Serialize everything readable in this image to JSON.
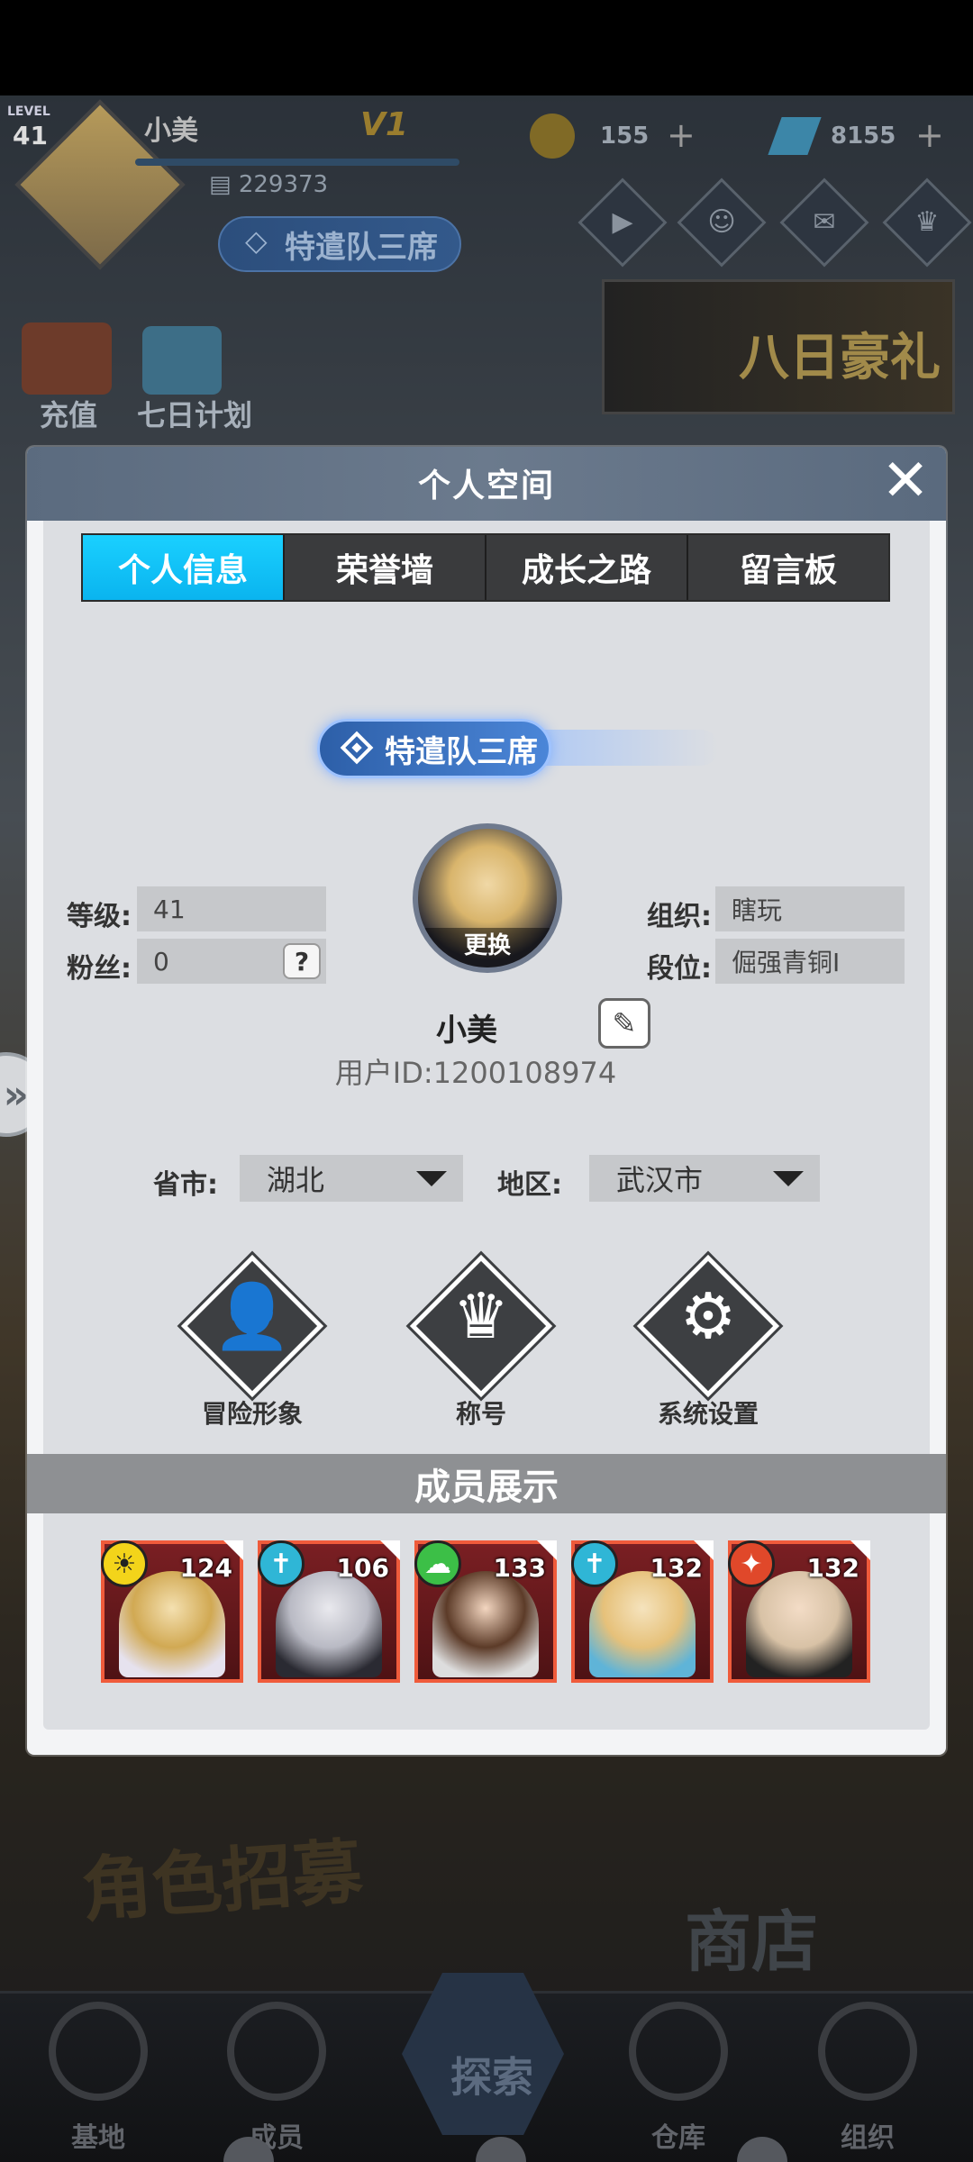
{
  "hud": {
    "level_caption": "LEVEL",
    "level": "41",
    "player_name": "小美",
    "vip": "V1",
    "player_id_display": "229373",
    "rank_title": "特遣队三席",
    "coins": "155",
    "gems": "8155",
    "recharge_label": "充值",
    "seven_day_label": "七日计划",
    "banner_text": "八日豪礼",
    "bg_sign_recruit": "角色招募",
    "bg_sign_shop": "商店"
  },
  "bottom_nav": {
    "items": [
      {
        "label": "基地",
        "icon": "base-icon"
      },
      {
        "label": "成员",
        "icon": "members-icon"
      },
      {
        "label": "探索",
        "icon": "explore-icon"
      },
      {
        "label": "仓库",
        "icon": "warehouse-icon"
      },
      {
        "label": "组织",
        "icon": "organization-icon"
      }
    ]
  },
  "modal": {
    "title": "个人空间",
    "close_icon": "✕",
    "tabs": [
      {
        "label": "个人信息",
        "active": true
      },
      {
        "label": "荣誉墙",
        "active": false
      },
      {
        "label": "成长之路",
        "active": false
      },
      {
        "label": "留言板",
        "active": false
      }
    ],
    "rank_badge": "特遣队三席",
    "fields": {
      "level_label": "等级:",
      "level_value": "41",
      "fans_label": "粉丝:",
      "fans_value": "0",
      "help_symbol": "?",
      "org_label": "组织:",
      "org_value": "瞎玩",
      "tier_label": "段位:",
      "tier_value": "倔强青铜Ⅰ"
    },
    "avatar_change_label": "更换",
    "player_name": "小美",
    "user_id": "用户ID:1200108974",
    "location": {
      "province_label": "省市:",
      "province_value": "湖北",
      "region_label": "地区:",
      "region_value": "武汉市"
    },
    "actions": [
      {
        "label": "冒险形象",
        "icon": "person-icon"
      },
      {
        "label": "称号",
        "icon": "crown-icon"
      },
      {
        "label": "系统设置",
        "icon": "gear-icon"
      }
    ],
    "members_title": "成员展示",
    "members": [
      {
        "level": "124",
        "element": "sun-element-icon",
        "elem_color": "#f3d41a"
      },
      {
        "level": "106",
        "element": "person-element-icon",
        "elem_color": "#2fb6d6"
      },
      {
        "level": "133",
        "element": "cloud-element-icon",
        "elem_color": "#3cbf47"
      },
      {
        "level": "132",
        "element": "person-element-icon",
        "elem_color": "#2fb6d6"
      },
      {
        "level": "132",
        "element": "fire-element-icon",
        "elem_color": "#e0482a"
      }
    ]
  },
  "colors": {
    "tab_active": "#0ab4ef",
    "tab_inactive": "#3a3b3d",
    "card_border": "#ef5b3b",
    "modal_header": "#6b7a8d"
  }
}
